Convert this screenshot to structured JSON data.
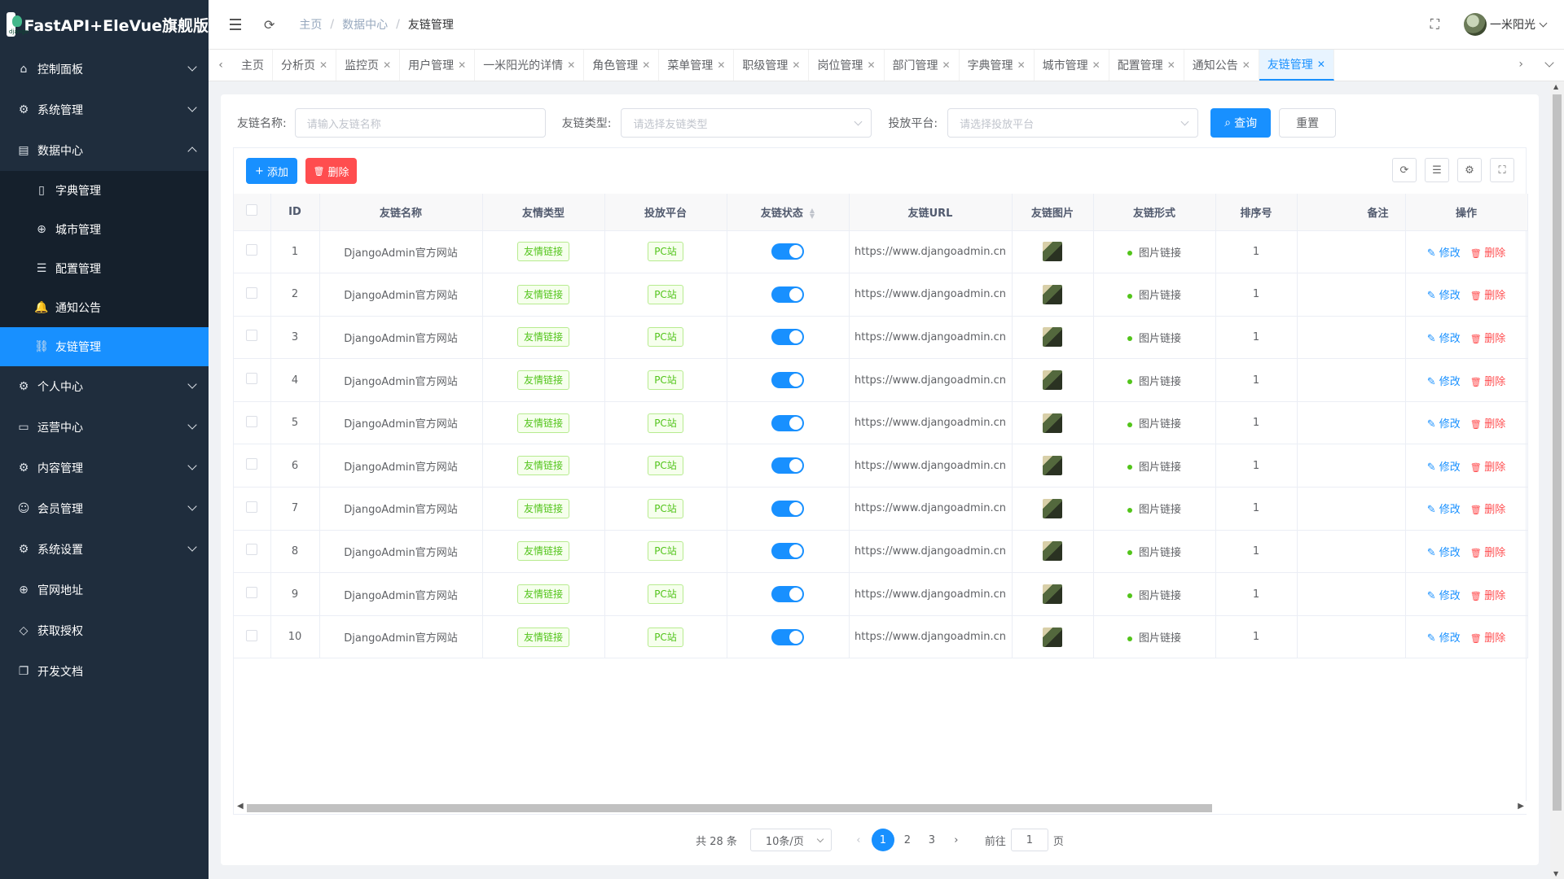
{
  "app": {
    "title": "FastAPI+EleVue旗舰版",
    "logo_text": "django"
  },
  "sidebar": {
    "items": [
      {
        "label": "控制面板",
        "icon": "home-icon",
        "expandable": true
      },
      {
        "label": "系统管理",
        "icon": "gear-icon",
        "expandable": true
      },
      {
        "label": "数据中心",
        "icon": "database-icon",
        "expandable": true,
        "expanded": true,
        "children": [
          {
            "label": "字典管理",
            "icon": "book-icon"
          },
          {
            "label": "城市管理",
            "icon": "globe-icon"
          },
          {
            "label": "配置管理",
            "icon": "list-icon"
          },
          {
            "label": "通知公告",
            "icon": "bell-icon"
          },
          {
            "label": "友链管理",
            "icon": "link-icon",
            "active": true
          }
        ]
      },
      {
        "label": "个人中心",
        "icon": "cogs-icon",
        "expandable": true
      },
      {
        "label": "运营中心",
        "icon": "card-icon",
        "expandable": true
      },
      {
        "label": "内容管理",
        "icon": "cogs-icon",
        "expandable": true
      },
      {
        "label": "会员管理",
        "icon": "user-icon",
        "expandable": true
      },
      {
        "label": "系统设置",
        "icon": "cogs-icon",
        "expandable": true
      },
      {
        "label": "官网地址",
        "icon": "globe-icon",
        "expandable": false
      },
      {
        "label": "获取授权",
        "icon": "diamond-icon",
        "expandable": false
      },
      {
        "label": "开发文档",
        "icon": "copy-icon",
        "expandable": false
      }
    ]
  },
  "header": {
    "breadcrumb": [
      "主页",
      "数据中心",
      "友链管理"
    ],
    "user_name": "一米阳光"
  },
  "tabs": [
    {
      "label": "主页",
      "closable": false
    },
    {
      "label": "分析页",
      "closable": true
    },
    {
      "label": "监控页",
      "closable": true
    },
    {
      "label": "用户管理",
      "closable": true
    },
    {
      "label": "一米阳光的详情",
      "closable": true
    },
    {
      "label": "角色管理",
      "closable": true
    },
    {
      "label": "菜单管理",
      "closable": true
    },
    {
      "label": "职级管理",
      "closable": true
    },
    {
      "label": "岗位管理",
      "closable": true
    },
    {
      "label": "部门管理",
      "closable": true
    },
    {
      "label": "字典管理",
      "closable": true
    },
    {
      "label": "城市管理",
      "closable": true
    },
    {
      "label": "配置管理",
      "closable": true
    },
    {
      "label": "通知公告",
      "closable": true
    },
    {
      "label": "友链管理",
      "closable": true,
      "active": true
    }
  ],
  "search": {
    "name_label": "友链名称:",
    "name_placeholder": "请输入友链名称",
    "type_label": "友链类型:",
    "type_placeholder": "请选择友链类型",
    "platform_label": "投放平台:",
    "platform_placeholder": "请选择投放平台",
    "query_label": "查询",
    "reset_label": "重置"
  },
  "toolbar": {
    "add_label": "添加",
    "delete_label": "删除"
  },
  "table": {
    "columns": [
      "ID",
      "友链名称",
      "友情类型",
      "投放平台",
      "友链状态",
      "友链URL",
      "友链图片",
      "友链形式",
      "排序号",
      "备注",
      "操作"
    ],
    "edit_label": "修改",
    "delete_label": "删除",
    "rows": [
      {
        "id": "1",
        "name": "DjangoAdmin官方网站",
        "type": "友情链接",
        "platform": "PC站",
        "status": true,
        "url": "https://www.djangoadmin.cn",
        "form": "图片链接",
        "sort": "1",
        "note": ""
      },
      {
        "id": "2",
        "name": "DjangoAdmin官方网站",
        "type": "友情链接",
        "platform": "PC站",
        "status": true,
        "url": "https://www.djangoadmin.cn",
        "form": "图片链接",
        "sort": "1",
        "note": ""
      },
      {
        "id": "3",
        "name": "DjangoAdmin官方网站",
        "type": "友情链接",
        "platform": "PC站",
        "status": true,
        "url": "https://www.djangoadmin.cn",
        "form": "图片链接",
        "sort": "1",
        "note": ""
      },
      {
        "id": "4",
        "name": "DjangoAdmin官方网站",
        "type": "友情链接",
        "platform": "PC站",
        "status": true,
        "url": "https://www.djangoadmin.cn",
        "form": "图片链接",
        "sort": "1",
        "note": ""
      },
      {
        "id": "5",
        "name": "DjangoAdmin官方网站",
        "type": "友情链接",
        "platform": "PC站",
        "status": true,
        "url": "https://www.djangoadmin.cn",
        "form": "图片链接",
        "sort": "1",
        "note": ""
      },
      {
        "id": "6",
        "name": "DjangoAdmin官方网站",
        "type": "友情链接",
        "platform": "PC站",
        "status": true,
        "url": "https://www.djangoadmin.cn",
        "form": "图片链接",
        "sort": "1",
        "note": ""
      },
      {
        "id": "7",
        "name": "DjangoAdmin官方网站",
        "type": "友情链接",
        "platform": "PC站",
        "status": true,
        "url": "https://www.djangoadmin.cn",
        "form": "图片链接",
        "sort": "1",
        "note": ""
      },
      {
        "id": "8",
        "name": "DjangoAdmin官方网站",
        "type": "友情链接",
        "platform": "PC站",
        "status": true,
        "url": "https://www.djangoadmin.cn",
        "form": "图片链接",
        "sort": "1",
        "note": ""
      },
      {
        "id": "9",
        "name": "DjangoAdmin官方网站",
        "type": "友情链接",
        "platform": "PC站",
        "status": true,
        "url": "https://www.djangoadmin.cn",
        "form": "图片链接",
        "sort": "1",
        "note": ""
      },
      {
        "id": "10",
        "name": "DjangoAdmin官方网站",
        "type": "友情链接",
        "platform": "PC站",
        "status": true,
        "url": "https://www.djangoadmin.cn",
        "form": "图片链接",
        "sort": "1",
        "note": ""
      }
    ]
  },
  "pager": {
    "total_text": "共 28 条",
    "page_size": "10条/页",
    "pages": [
      "1",
      "2",
      "3"
    ],
    "current_page": "1",
    "goto_prefix": "前往",
    "goto_value": "1",
    "goto_suffix": "页"
  },
  "colors": {
    "primary": "#1890ff",
    "danger": "#ff4d4f",
    "success": "#52c41a",
    "sidebar_bg": "#1f2d3d"
  }
}
